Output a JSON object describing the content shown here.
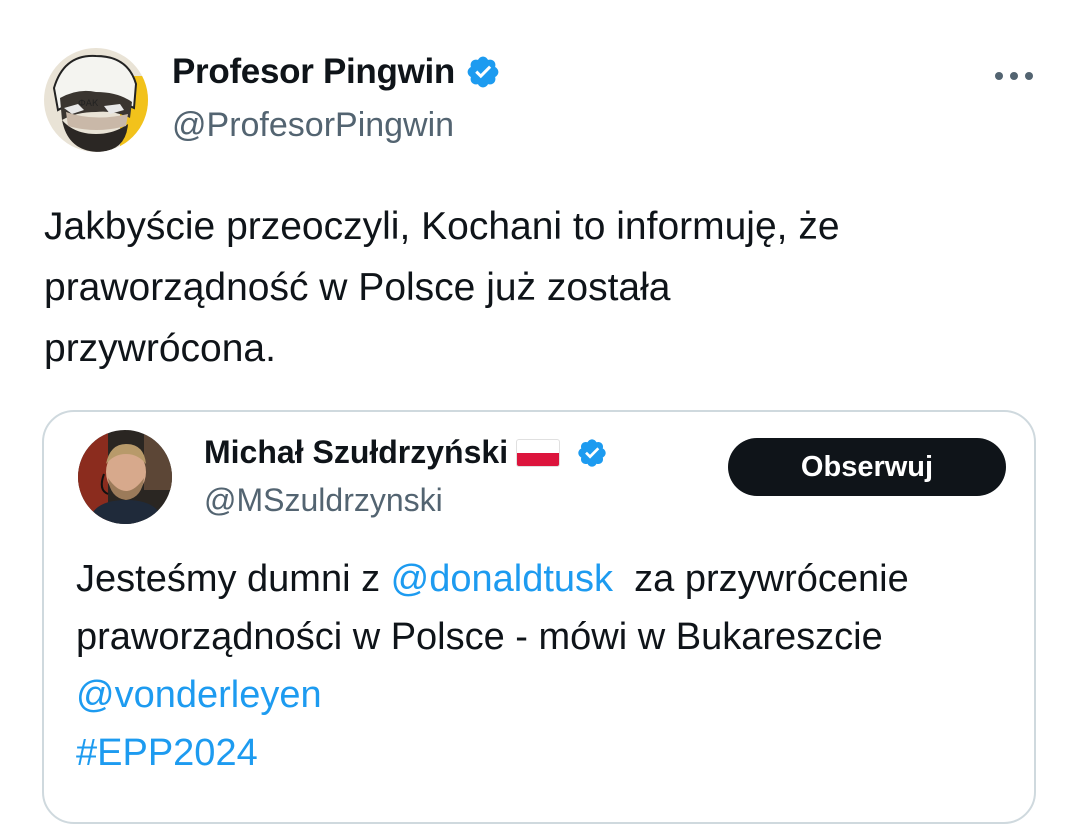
{
  "tweet": {
    "author_name": "Profesor Pingwin",
    "author_handle": "@ProfesorPingwin",
    "text": "Jakbyście przeoczyli, Kochani to informuję, że\npraworządność w Polsce już została\nprzywrócona.",
    "avatar_icon": "cartoon-avatar-icon",
    "verified_icon": "verified-badge-icon",
    "more_icon": "more-options-icon"
  },
  "quoted": {
    "author_name": "Michał Szułdrzyński",
    "author_handle": "@MSzuldrzynski",
    "follow_label": "Obserwuj",
    "flag_icon": "poland-flag-icon",
    "text_part1": "Jesteśmy dumni z ",
    "mention1": "@donaldtusk",
    "text_part2": "  za przywrócenie praworządności w Polsce - mówi w Bukareszcie ",
    "mention2": "@vonderleyen",
    "hashtag": "#EPP2024"
  },
  "colors": {
    "link": "#1d9bf0",
    "verified": "#1d9bf0",
    "text": "#0f1419",
    "secondary": "#536471",
    "border": "#cfd9de",
    "button": "#0f1419"
  }
}
